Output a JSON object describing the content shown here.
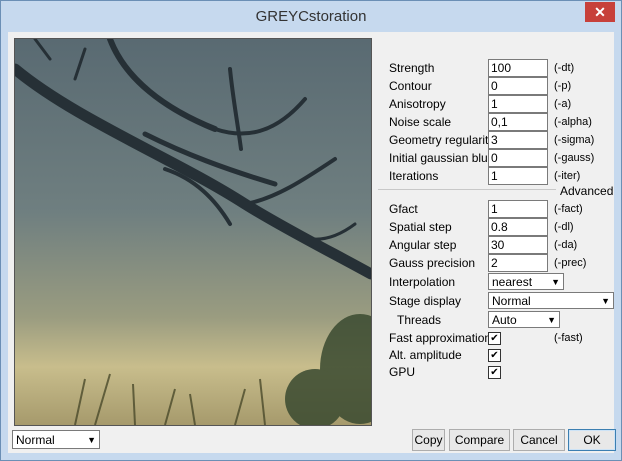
{
  "window": {
    "title": "GREYCstoration",
    "close_symbol": "✕"
  },
  "params": [
    {
      "label": "Strength",
      "value": "100",
      "flag": "(-dt)"
    },
    {
      "label": "Contour",
      "value": "0",
      "flag": "(-p)"
    },
    {
      "label": "Anisotropy",
      "value": "1",
      "flag": "(-a)"
    },
    {
      "label": "Noise scale",
      "value": "0,1",
      "flag": "(-alpha)"
    },
    {
      "label": "Geometry regularity",
      "value": "3",
      "flag": "(-sigma)"
    },
    {
      "label": "Initial gaussian blur",
      "value": "0",
      "flag": "(-gauss)"
    },
    {
      "label": "Iterations",
      "value": "1",
      "flag": "(-iter)"
    }
  ],
  "advanced_label": "Advanced",
  "advanced_params": [
    {
      "label": "Gfact",
      "value": "1",
      "flag": "(-fact)"
    },
    {
      "label": "Spatial step",
      "value": "0.8",
      "flag": "(-dl)"
    },
    {
      "label": "Angular step",
      "value": "30",
      "flag": "(-da)"
    },
    {
      "label": "Gauss precision",
      "value": "2",
      "flag": "(-prec)"
    }
  ],
  "interpolation": {
    "label": "Interpolation",
    "value": "nearest"
  },
  "stage_display": {
    "label": "Stage display",
    "value": "Normal"
  },
  "threads": {
    "label": "Threads",
    "value": "Auto"
  },
  "checks": [
    {
      "label": "Fast approximation",
      "checked": true,
      "flag": "(-fast)"
    },
    {
      "label": "Alt. amplitude",
      "checked": true,
      "flag": ""
    },
    {
      "label": "GPU",
      "checked": true,
      "flag": ""
    }
  ],
  "check_mark": "✔",
  "view_mode": {
    "value": "Normal"
  },
  "buttons": {
    "copy": "Copy",
    "compare": "Compare",
    "cancel": "Cancel",
    "ok": "OK"
  },
  "dropdown_arrow": "▼"
}
